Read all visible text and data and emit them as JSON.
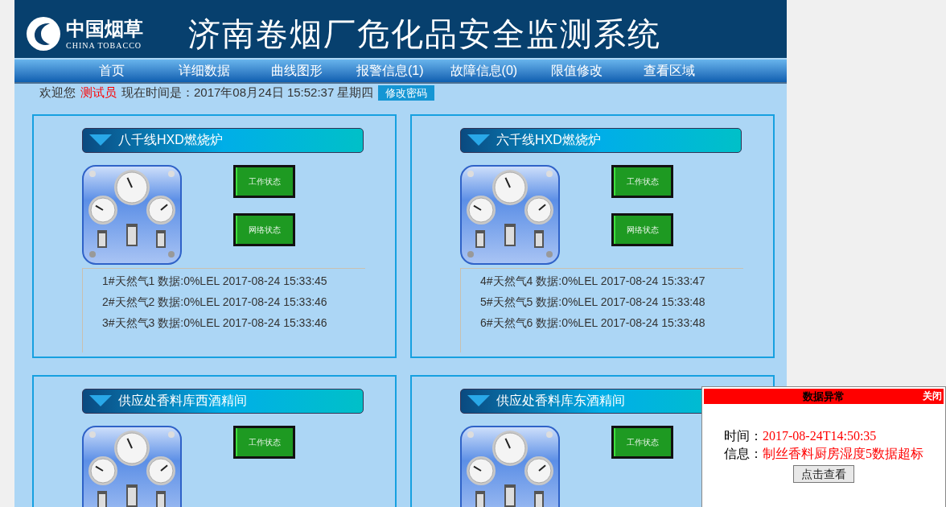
{
  "logo": {
    "name": "中国烟草",
    "subtitle": "CHINA TOBACCO"
  },
  "header": {
    "title": "济南卷烟厂危化品安全监测系统"
  },
  "nav": [
    {
      "label": "首页",
      "selected": false
    },
    {
      "label": "详细数据",
      "selected": false
    },
    {
      "label": "曲线图形",
      "selected": false
    },
    {
      "label": "报警信息(1)",
      "selected": false
    },
    {
      "label": "故障信息(0)",
      "selected": false
    },
    {
      "label": "限值修改",
      "selected": false
    },
    {
      "label": "查看区域",
      "selected": false
    }
  ],
  "welcome": {
    "greeting": "欢迎您",
    "user": "测试员",
    "time": "现在时间是：2017年08月24日 15:52:37 星期四",
    "change_password": "修改密码"
  },
  "panels": [
    {
      "title": "八千线HXD燃烧炉",
      "work_status": "工作状态",
      "network_status": "网络状态",
      "readings": [
        "1#天然气1 数据:0%LEL 2017-08-24 15:33:45",
        "2#天然气2 数据:0%LEL 2017-08-24 15:33:46",
        "3#天然气3 数据:0%LEL 2017-08-24 15:33:46"
      ]
    },
    {
      "title": "六千线HXD燃烧炉",
      "work_status": "工作状态",
      "network_status": "网络状态",
      "readings": [
        "4#天然气4 数据:0%LEL 2017-08-24 15:33:47",
        "5#天然气5 数据:0%LEL 2017-08-24 15:33:48",
        "6#天然气6 数据:0%LEL 2017-08-24 15:33:48"
      ]
    },
    {
      "title": "供应处香料库西酒精间",
      "work_status": "工作状态"
    },
    {
      "title": "供应处香料库东酒精间",
      "work_status": "工作状态"
    }
  ],
  "alert": {
    "title": "数据异常",
    "close": "关闭",
    "time_label": "时间：",
    "time": "2017-08-24T14:50:35",
    "info_label": "信息：",
    "info": "制丝香料厨房湿度5数据超标",
    "button": "点击查看"
  }
}
